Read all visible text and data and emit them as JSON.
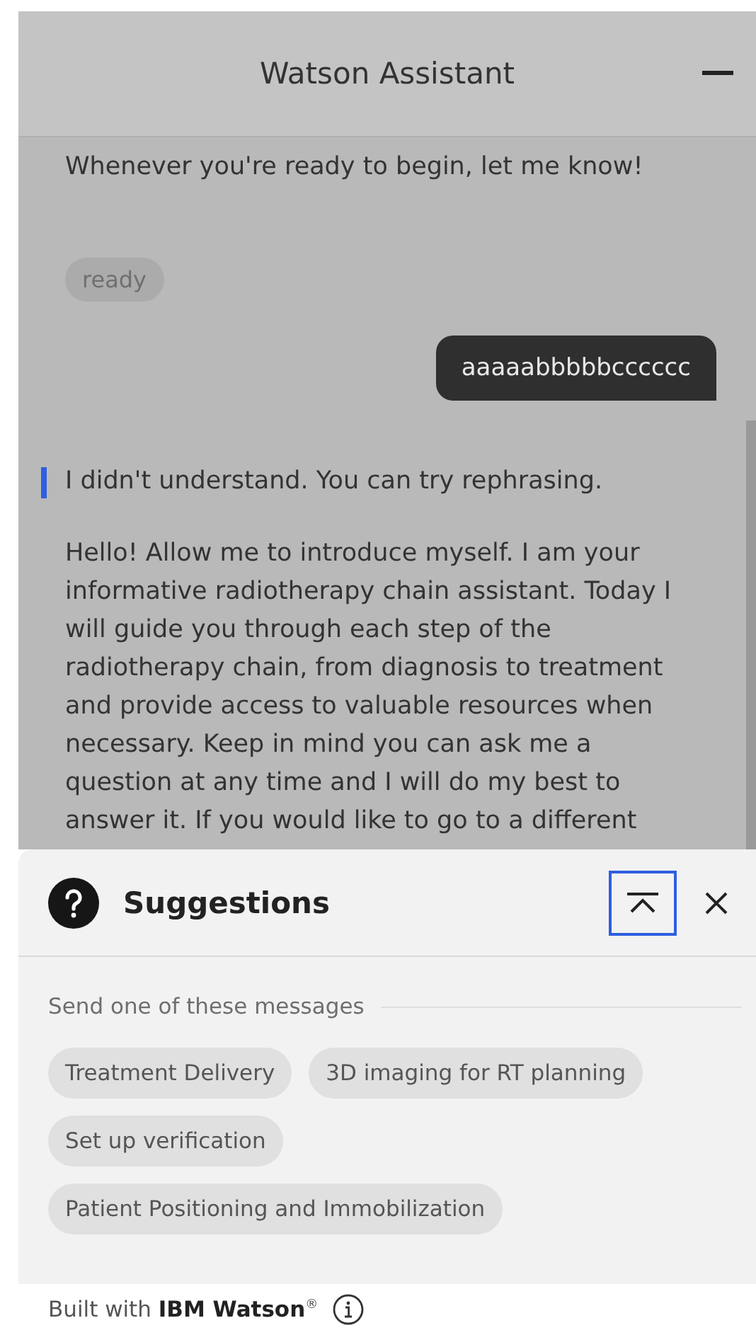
{
  "header": {
    "title": "Watson Assistant"
  },
  "messages": [
    {
      "kind": "bot",
      "text": "Whenever you're ready to begin, let me know!"
    },
    {
      "kind": "chip",
      "text": "ready"
    },
    {
      "kind": "user",
      "text": "aaaaabbbbbcccccc"
    },
    {
      "kind": "error",
      "text": "I didn't understand. You can try rephrasing."
    },
    {
      "kind": "bot",
      "text": "Hello! Allow me to introduce myself. I am your informative radiotherapy chain assistant. Today I will guide you through each step of the radiotherapy chain, from diagnosis to treatment and provide access to valuable resources when necessary. Keep in mind you can ask me a question at any time and I will do my best to answer it. If you would like to go to a different"
    }
  ],
  "suggestions": {
    "title": "Suggestions",
    "collapse_focused": true,
    "prompt": "Send one of these messages",
    "options": [
      "Treatment Delivery",
      "3D imaging for RT planning",
      "Set up verification",
      "Patient Positioning and Immobilization"
    ]
  },
  "footer": {
    "text": "Built with **IBM Watson**$^{®}$"
  }
}
